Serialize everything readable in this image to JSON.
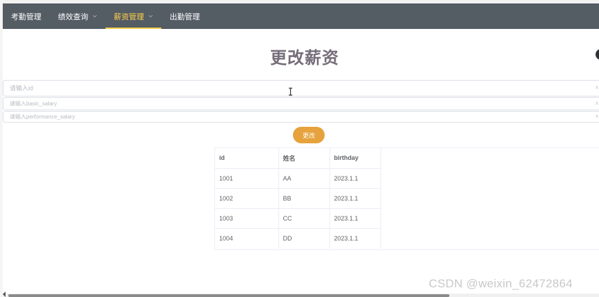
{
  "nav": {
    "items": [
      {
        "label": "考勤管理",
        "has_dropdown": false,
        "active": false
      },
      {
        "label": "绩效查询",
        "has_dropdown": true,
        "active": false
      },
      {
        "label": "薪资管理",
        "has_dropdown": true,
        "active": true
      },
      {
        "label": "出勤管理",
        "has_dropdown": false,
        "active": false
      }
    ],
    "background_color": "#545c64",
    "active_color": "#ffd04b"
  },
  "page": {
    "title": "更改薪资"
  },
  "form": {
    "id_placeholder": "请输入id",
    "basic_salary_placeholder": "请输入basic_salary",
    "performance_salary_placeholder": "请输入performance_salary",
    "submit_label": "更改",
    "submit_color": "#e6a23c"
  },
  "table": {
    "headers": [
      "id",
      "姓名",
      "birthday"
    ],
    "rows": [
      [
        "1001",
        "AA",
        "2023.1.1"
      ],
      [
        "1002",
        "BB",
        "2023.1.1"
      ],
      [
        "1003",
        "CC",
        "2023.1.1"
      ],
      [
        "1004",
        "DD",
        "2023.1.1"
      ]
    ]
  },
  "watermark": "CSDN @weixin_62472864",
  "icons": [
    "chevron-down-icon",
    "text-cursor-icon",
    "scroll-left-arrow-icon"
  ]
}
